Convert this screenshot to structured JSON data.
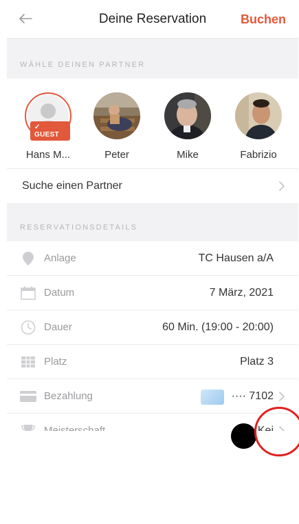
{
  "nav": {
    "back_icon": "arrow-left-icon",
    "title": "Deine Reservation",
    "action": "Buchen"
  },
  "partner_section": {
    "header": "WÄHLE DEINEN PARTNER",
    "partners": [
      {
        "name": "Hans M...",
        "badge": "✓ GUEST"
      },
      {
        "name": "Peter"
      },
      {
        "name": "Mike"
      },
      {
        "name": "Fabrizio"
      }
    ],
    "search_label": "Suche einen Partner"
  },
  "details_section": {
    "header": "RESERVATIONSDETAILS",
    "rows": [
      {
        "label": "Anlage",
        "value": "TC Hausen a/A",
        "icon": "location-pin-icon"
      },
      {
        "label": "Datum",
        "value": "7 März, 2021",
        "icon": "calendar-icon"
      },
      {
        "label": "Dauer",
        "value": "60 Min. (19:00 - 20:00)",
        "icon": "clock-icon"
      },
      {
        "label": "Platz",
        "value": "Platz 3",
        "icon": "court-icon"
      },
      {
        "label": "Bezahlung",
        "value": "···· 7102",
        "icon": "credit-card-icon"
      },
      {
        "label": "Meisterschaft",
        "value": "Kei",
        "icon": "trophy-icon"
      }
    ]
  },
  "colors": {
    "accent": "#e2583a",
    "background": "#f2f2f4",
    "annotation_circle": "#e0201e"
  }
}
